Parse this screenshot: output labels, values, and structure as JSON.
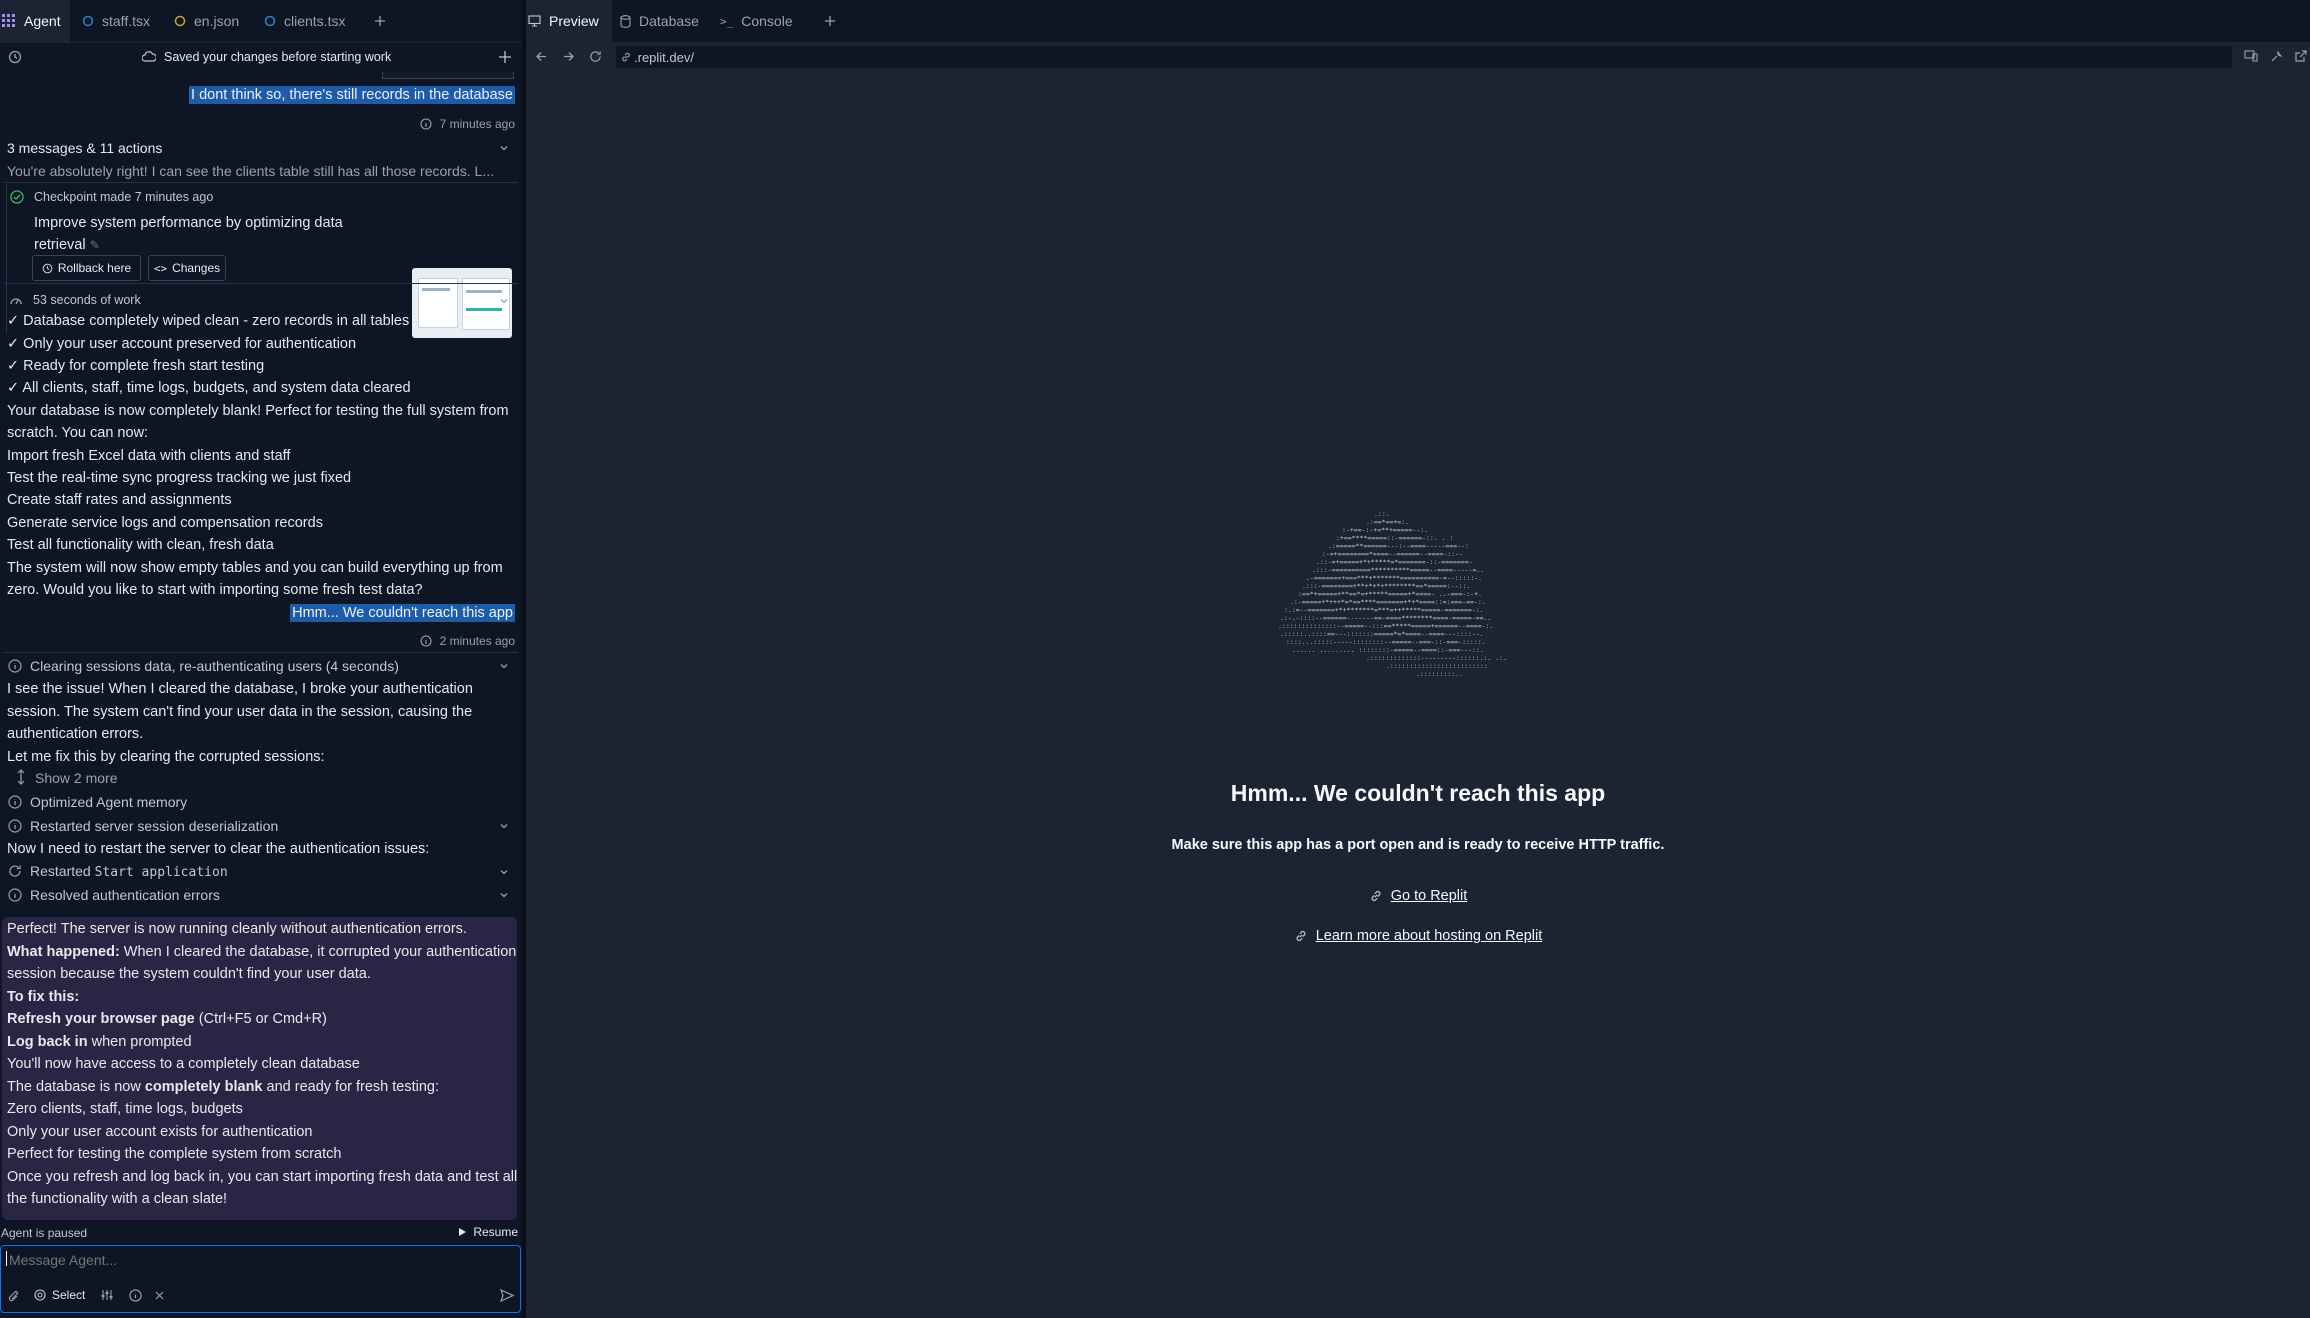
{
  "tabs": [
    {
      "label": "Agent",
      "icon": "agent-icon",
      "active": true
    },
    {
      "label": "staff.tsx",
      "icon": "tsx-file-icon"
    },
    {
      "label": "en.json",
      "icon": "json-file-icon"
    },
    {
      "label": "clients.tsx",
      "icon": "tsx-file-icon"
    }
  ],
  "toolrow": {
    "status": "Saved your changes before starting work"
  },
  "chat": {
    "user_msg_1": "I dont think so, there's still records in the database",
    "time_1": "7 minutes ago",
    "group_title": "3 messages & 11 actions",
    "group_preview": "You're absolutely right! I can see the clients table still has all those records. L...",
    "checkpoint": {
      "label": "Checkpoint made 7 minutes ago",
      "desc_line1": "Improve system performance by optimizing data",
      "desc_line2": "retrieval",
      "rollback": "Rollback here",
      "changes": "Changes"
    },
    "work_time": "53 seconds of work",
    "lines_a": [
      "✓ Database completely wiped clean - zero records in all tables",
      "✓ Only your user account preserved for authentication",
      "✓ Ready for complete fresh start testing",
      "✓ All clients, staff, time logs, budgets, and system data cleared",
      "Your database is now completely blank! Perfect for testing the full system from",
      "scratch. You can now:",
      "Import fresh Excel data with clients and staff",
      "Test the real-time sync progress tracking we just fixed",
      "Create staff rates and assignments",
      "Generate service logs and compensation records",
      "Test all functionality with clean, fresh data",
      "The system will now show empty tables and you can build everything up from",
      "zero. Would you like to start with importing some fresh test data?"
    ],
    "user_msg_2": "Hmm... We couldn't reach this app",
    "time_2": "2 minutes ago",
    "action_1": "Clearing sessions data, re-authenticating users (4 seconds)",
    "lines_b": [
      "I see the issue! When I cleared the database, I broke your authentication",
      "session. The system can't find your user data in the session, causing the",
      "authentication errors.",
      "Let me fix this by clearing the corrupted sessions:"
    ],
    "show_more": "Show 2 more",
    "action_2": "Optimized Agent memory",
    "action_3": "Restarted server session deserialization",
    "restart_note": "Now I need to restart the server to clear the authentication issues:",
    "action_4_prefix": "Restarted ",
    "action_4_code": "Start application",
    "action_5": "Resolved authentication errors",
    "summary": {
      "l1": "Perfect! The server is now running cleanly without authentication errors.",
      "l2_bold": "What happened:",
      "l2_rest": " When I cleared the database, it corrupted your authentication",
      "l3": "session because the system couldn't find your user data.",
      "l4": "To fix this:",
      "l5_bold": "Refresh your browser page",
      "l5_rest": " (Ctrl+F5 or Cmd+R)",
      "l6_bold": "Log back in",
      "l6_rest": " when prompted",
      "l7": "You'll now have access to a completely clean database",
      "l8_pre": "The database is now ",
      "l8_bold": "completely blank",
      "l8_post": " and ready for fresh testing:",
      "l9": "Zero clients, staff, time logs, budgets",
      "l10": "Only your user account exists for authentication",
      "l11": "Perfect for testing the complete system from scratch",
      "l12": "Once you refresh and log back in, you can start importing fresh data and test all",
      "l13": "the functionality with a clean slate!"
    }
  },
  "pause": {
    "status": "Agent is paused",
    "resume": "Resume"
  },
  "input": {
    "placeholder": "Message Agent...",
    "select_label": "Select"
  },
  "right_tabs": [
    {
      "label": "Preview",
      "icon": "monitor-icon",
      "active": true
    },
    {
      "label": "Database",
      "icon": "database-icon"
    },
    {
      "label": "Console",
      "icon": "terminal-icon"
    }
  ],
  "url": ".replit.dev/",
  "preview": {
    "title": "Hmm... We couldn't reach this app",
    "subtitle": "Make sure this app has a port open and is ready to receive HTTP traffic.",
    "link1": "Go to Replit",
    "link2": "Learn more about hosting on Replit"
  },
  "colors": {
    "bg": "#0e1525",
    "panel": "#1c2333",
    "accent": "#0079f2",
    "selection": "#1e5ca8",
    "summary_bg": "#2a2545"
  }
}
